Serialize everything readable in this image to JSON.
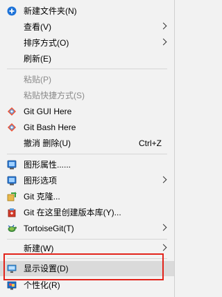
{
  "menu": {
    "items": [
      {
        "label": "新建文件夹(N)",
        "icon": "new-folder-icon"
      },
      {
        "label": "查看(V)"
      },
      {
        "label": "排序方式(O)"
      },
      {
        "label": "刷新(E)"
      },
      {
        "label": "粘贴(P)"
      },
      {
        "label": "粘贴快捷方式(S)"
      },
      {
        "label": "Git GUI Here",
        "icon": "git-gui-icon"
      },
      {
        "label": "Git Bash Here",
        "icon": "git-bash-icon"
      },
      {
        "label": "撤消 删除(U)",
        "shortcut": "Ctrl+Z"
      },
      {
        "label": "图形属性......",
        "icon": "graphics-properties-icon"
      },
      {
        "label": "图形选项",
        "icon": "graphics-options-icon"
      },
      {
        "label": "Git 克隆...",
        "icon": "git-clone-icon"
      },
      {
        "label": "Git 在这里创建版本库(Y)...",
        "icon": "git-create-repo-icon"
      },
      {
        "label": "TortoiseGit(T)",
        "icon": "tortoisegit-icon"
      },
      {
        "label": "新建(W)"
      },
      {
        "label": "显示设置(D)",
        "icon": "display-settings-icon"
      },
      {
        "label": "个性化(R)",
        "icon": "personalize-icon"
      }
    ]
  },
  "colors": {
    "menu_background": "#f2f2f2",
    "disabled_text": "#8a8a8a",
    "highlight_box": "#e2231a"
  }
}
